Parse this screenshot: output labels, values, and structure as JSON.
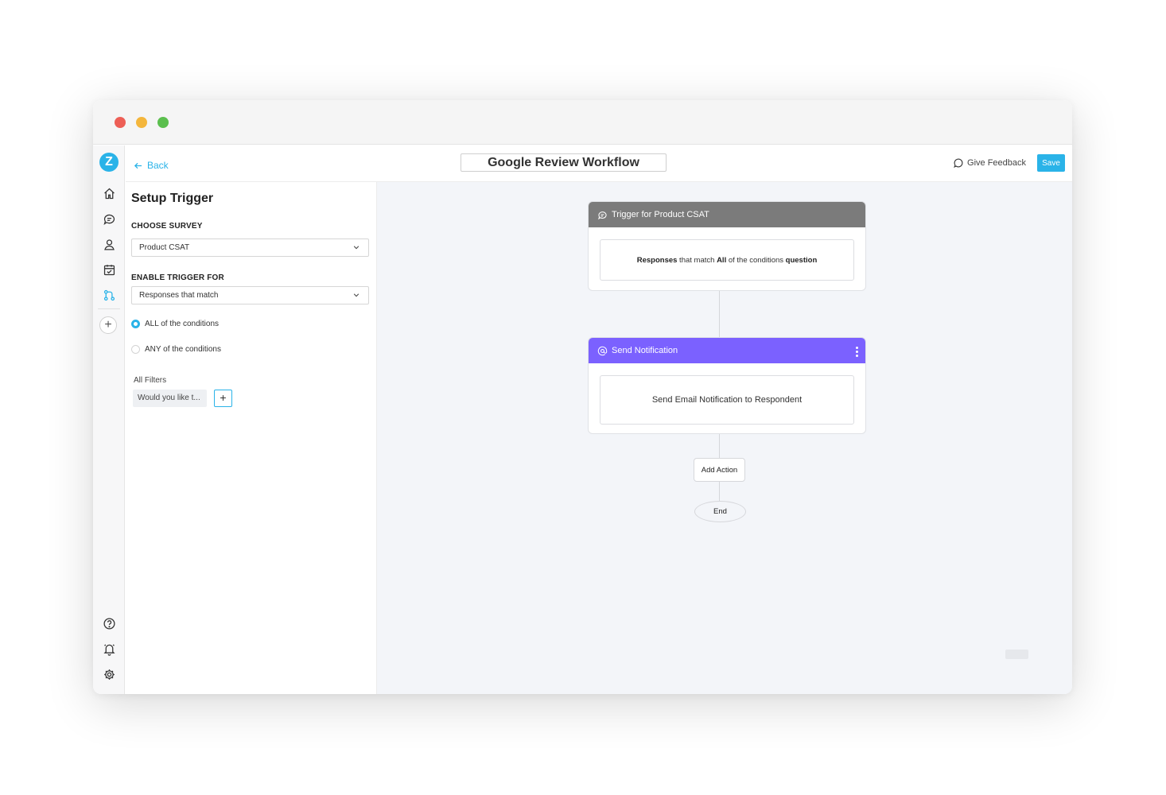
{
  "header": {
    "back_label": "Back",
    "workflow_title": "Google Review Workflow",
    "feedback_label": "Give Feedback",
    "save_label": "Save"
  },
  "rail": {
    "logo_letter": "Z",
    "icons": [
      "home-icon",
      "chat-icon",
      "user-icon",
      "calendar-check-icon",
      "workflow-icon",
      "plus-icon",
      "help-icon",
      "bell-icon",
      "settings-icon"
    ]
  },
  "panel": {
    "title": "Setup Trigger",
    "choose_survey_label": "CHOOSE SURVEY",
    "survey_value": "Product CSAT",
    "enable_trigger_label": "ENABLE TRIGGER FOR",
    "trigger_value": "Responses that match",
    "radio_all": "ALL of the conditions",
    "radio_any": "ANY of the conditions",
    "filters_label": "All Filters",
    "filter_chip": "Would you like t...",
    "add_filter": "+"
  },
  "flow": {
    "trigger_title": "Trigger for Product CSAT",
    "trigger_body": {
      "b1": "Responses",
      "t1": " that match ",
      "b2": "All",
      "t2": " of the conditions ",
      "b3": "question"
    },
    "notification_title": "Send Notification",
    "notification_body": "Send Email Notification to Respondent",
    "add_action": "Add Action",
    "end": "End"
  },
  "colors": {
    "accent": "#2ab3e8",
    "trigger_header": "#7b7b7b",
    "notification_header": "#7b61ff"
  }
}
